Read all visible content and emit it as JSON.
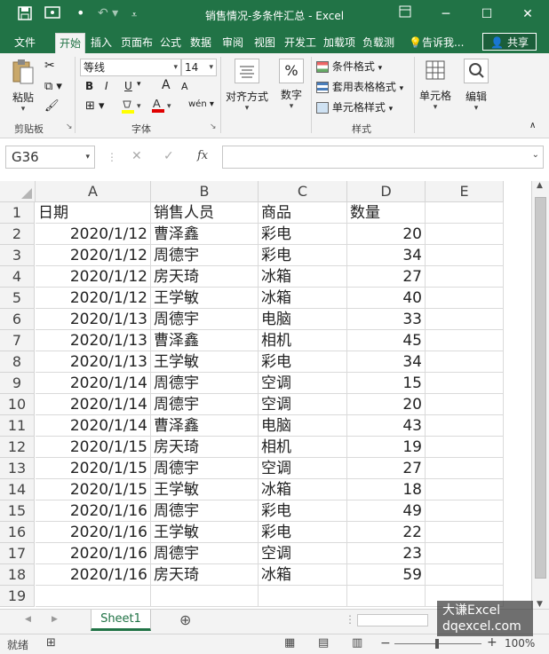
{
  "window": {
    "title": "销售情况-多条件汇总 - Excel",
    "accent": "#217346"
  },
  "quick_access": [
    "save-icon",
    "touch-mode-icon",
    "dot-icon",
    "undo-icon",
    "customize-icon"
  ],
  "tabs": [
    {
      "label": "文件"
    },
    {
      "label": "开始",
      "active": true
    },
    {
      "label": "插入"
    },
    {
      "label": "页面布"
    },
    {
      "label": "公式"
    },
    {
      "label": "数据"
    },
    {
      "label": "审阅"
    },
    {
      "label": "视图"
    },
    {
      "label": "开发工"
    },
    {
      "label": "加载项"
    },
    {
      "label": "负载测"
    },
    {
      "label": "告诉我..."
    }
  ],
  "share_label": "共享",
  "ribbon": {
    "clipboard": {
      "paste_label": "粘贴",
      "group_label": "剪贴板"
    },
    "font": {
      "font_name": "等线",
      "font_size": "14",
      "group_label": "字体",
      "bold": "B",
      "italic": "I",
      "underline": "U",
      "grow": "A",
      "shrink": "A"
    },
    "alignment": {
      "label": "对齐方式"
    },
    "number": {
      "label": "数字",
      "symbol": "%"
    },
    "styles": {
      "conditional": "条件格式",
      "table": "套用表格格式",
      "cell": "单元格样式",
      "group_label": "样式"
    },
    "cells": {
      "label": "单元格"
    },
    "editing": {
      "label": "编辑"
    }
  },
  "formula_bar": {
    "name_box": "G36",
    "fx": "fx",
    "formula": ""
  },
  "columns": [
    "A",
    "B",
    "C",
    "D",
    "E"
  ],
  "header_row": [
    "日期",
    "销售人员",
    "商品",
    "数量"
  ],
  "rows": [
    [
      "2020/1/12",
      "曹泽鑫",
      "彩电",
      "20"
    ],
    [
      "2020/1/12",
      "周德宇",
      "彩电",
      "34"
    ],
    [
      "2020/1/12",
      "房天琦",
      "冰箱",
      "27"
    ],
    [
      "2020/1/12",
      "王学敏",
      "冰箱",
      "40"
    ],
    [
      "2020/1/13",
      "周德宇",
      "电脑",
      "33"
    ],
    [
      "2020/1/13",
      "曹泽鑫",
      "相机",
      "45"
    ],
    [
      "2020/1/13",
      "王学敏",
      "彩电",
      "34"
    ],
    [
      "2020/1/14",
      "周德宇",
      "空调",
      "15"
    ],
    [
      "2020/1/14",
      "周德宇",
      "空调",
      "20"
    ],
    [
      "2020/1/14",
      "曹泽鑫",
      "电脑",
      "43"
    ],
    [
      "2020/1/15",
      "房天琦",
      "相机",
      "19"
    ],
    [
      "2020/1/15",
      "周德宇",
      "空调",
      "27"
    ],
    [
      "2020/1/15",
      "王学敏",
      "冰箱",
      "18"
    ],
    [
      "2020/1/16",
      "周德宇",
      "彩电",
      "49"
    ],
    [
      "2020/1/16",
      "王学敏",
      "彩电",
      "22"
    ],
    [
      "2020/1/16",
      "周德宇",
      "空调",
      "23"
    ],
    [
      "2020/1/16",
      "房天琦",
      "冰箱",
      "59"
    ]
  ],
  "sheet": {
    "tab_label": "Sheet1",
    "add_symbol": "⊕"
  },
  "status": {
    "mode": "就绪",
    "zoom": "100%",
    "zoom_minus": "−",
    "zoom_plus": "+"
  },
  "watermark": {
    "line1": "大谦Excel",
    "line2": "dqexcel.com"
  }
}
